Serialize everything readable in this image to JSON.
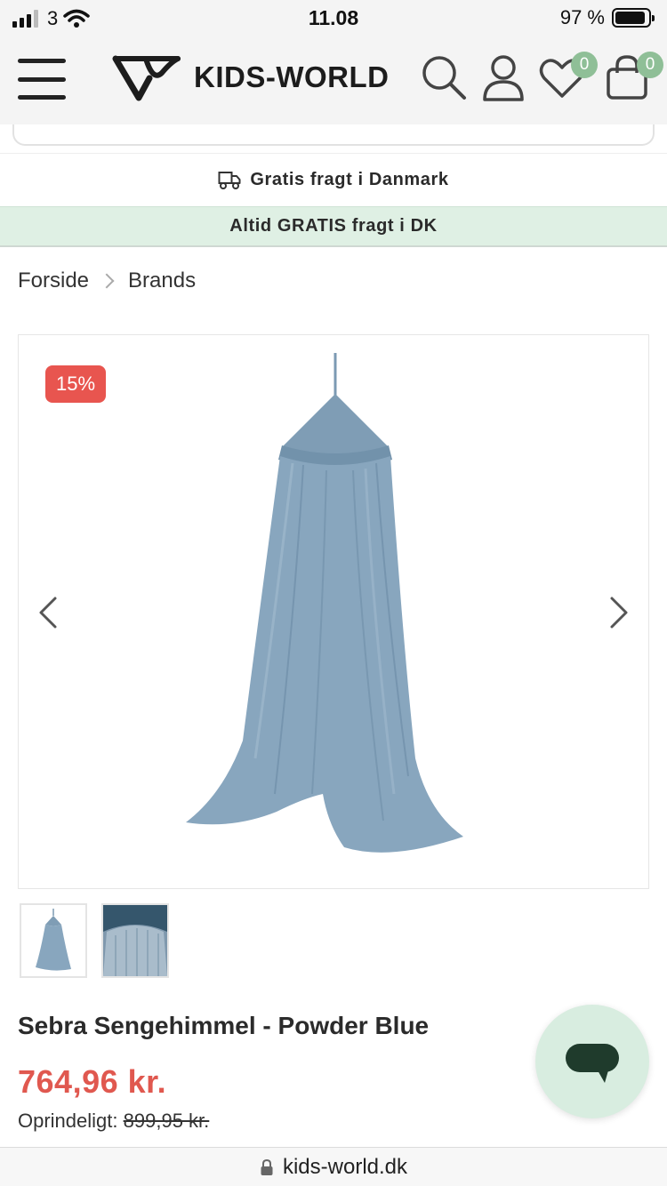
{
  "status_bar": {
    "carrier": "3",
    "time": "11.08",
    "battery": "97 %"
  },
  "header": {
    "logo_text": "KIDS-WORLD",
    "wishlist_count": "0",
    "cart_count": "0"
  },
  "shipping_banner": "Gratis fragt i Danmark",
  "promo_banner": "Altid GRATIS fragt i DK",
  "breadcrumb": {
    "items": [
      "Forside",
      "Brands"
    ]
  },
  "product": {
    "discount_badge": "15%",
    "title": "Sebra Sengehimmel - Powder Blue",
    "price": "764,96 kr.",
    "original_label": "Oprindeligt:",
    "original_price": "899,95 kr."
  },
  "colors": {
    "accent_green": "#8fbf97",
    "promo_bg": "#dff0e4",
    "price_red": "#e0584f",
    "canopy_blue": "#7c9ab3"
  },
  "icons": {
    "menu": "hamburger-icon",
    "search": "search-icon",
    "account": "user-icon",
    "wishlist": "heart-icon",
    "cart": "bag-icon",
    "truck": "truck-icon",
    "lock": "lock-icon",
    "chat": "chat-icon"
  },
  "browser": {
    "url": "kids-world.dk"
  }
}
